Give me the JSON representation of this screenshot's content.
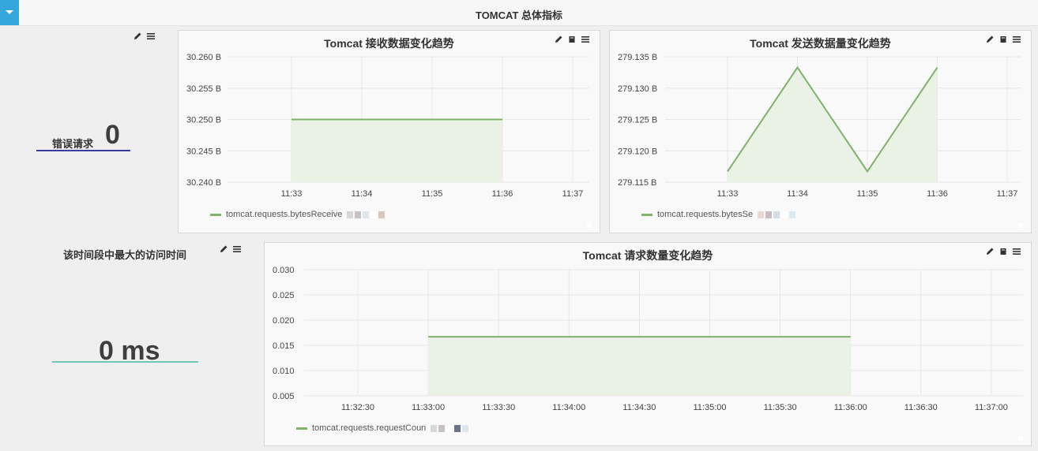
{
  "row": {
    "title": "TOMCAT 总体指标"
  },
  "icons": {
    "edit": "pencil-icon",
    "book": "book-icon",
    "menu": "menu-icon",
    "collapse": "caret-down-icon"
  },
  "colors": {
    "series": "#7eb26d",
    "fill": "#eaf1e5",
    "accent": "#35a7dd",
    "error_underline": "#3b3ba6",
    "ms_underline": "#6fc7b6"
  },
  "singlestat_errors": {
    "label": "错误请求",
    "value": "0"
  },
  "singlestat_max": {
    "label": "该时间段中最大的访问时间",
    "value": "0 ms"
  },
  "chart_data": [
    {
      "type": "area",
      "title": "Tomcat 接收数据变化趋势",
      "yticks": [
        "30.260 B",
        "30.255 B",
        "30.250 B",
        "30.245 B",
        "30.240 B"
      ],
      "ylim": [
        30.24,
        30.26
      ],
      "xticks": [
        "11:33",
        "11:34",
        "11:35",
        "11:36",
        "11:37"
      ],
      "series": [
        {
          "name": "tomcat.requests.bytesReceive",
          "x": [
            "11:33",
            "11:34",
            "11:35",
            "11:36"
          ],
          "values": [
            30.25,
            30.25,
            30.25,
            30.25
          ]
        }
      ]
    },
    {
      "type": "area",
      "title": "Tomcat 发送数据量变化趋势",
      "yticks": [
        "279.135 B",
        "279.130 B",
        "279.125 B",
        "279.120 B",
        "279.115 B"
      ],
      "ylim": [
        279.115,
        279.135
      ],
      "xticks": [
        "11:33",
        "11:34",
        "11:35",
        "11:36",
        "11:37"
      ],
      "series": [
        {
          "name": "tomcat.requests.bytesSe",
          "x": [
            "11:33",
            "11:34",
            "11:35",
            "11:36"
          ],
          "values": [
            279.1167,
            279.1333,
            279.1167,
            279.1333
          ]
        }
      ]
    },
    {
      "type": "area",
      "title": "Tomcat 请求数量变化趋势",
      "yticks": [
        "0.030",
        "0.025",
        "0.020",
        "0.015",
        "0.010",
        "0.005"
      ],
      "ylim": [
        0.005,
        0.03
      ],
      "xticks": [
        "11:32:30",
        "11:33:00",
        "11:33:30",
        "11:34:00",
        "11:34:30",
        "11:35:00",
        "11:35:30",
        "11:36:00",
        "11:36:30",
        "11:37:00"
      ],
      "series": [
        {
          "name": "tomcat.requests.requestCoun",
          "x": [
            "11:33:00",
            "11:33:30",
            "11:34:00",
            "11:34:30",
            "11:35:00",
            "11:35:30",
            "11:36:00"
          ],
          "values": [
            0.0167,
            0.0167,
            0.0167,
            0.0167,
            0.0167,
            0.0167,
            0.0167
          ]
        }
      ]
    }
  ]
}
